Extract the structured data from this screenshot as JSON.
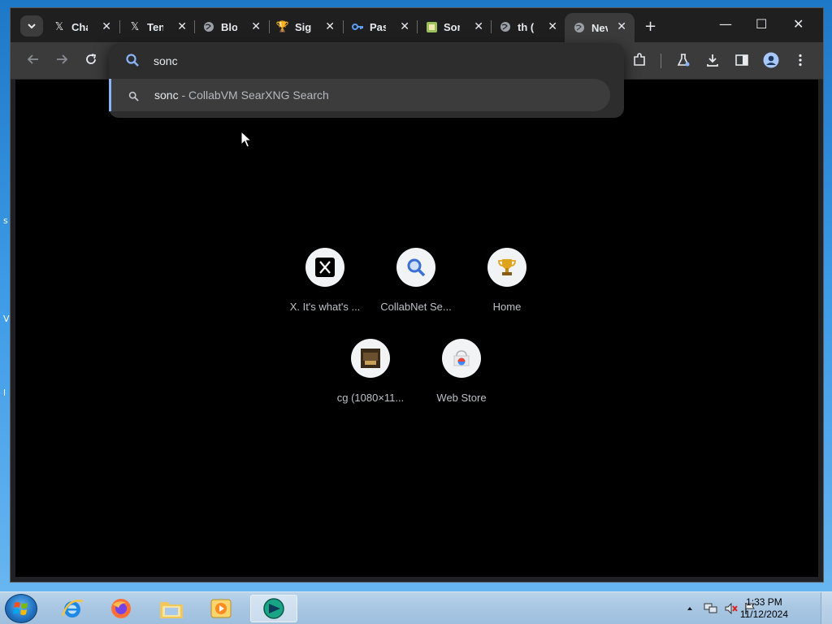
{
  "browser": {
    "tabs": [
      {
        "title": "Cha",
        "favicon": "x-logo-icon"
      },
      {
        "title": "Ten",
        "favicon": "x-logo-icon"
      },
      {
        "title": "Blo",
        "favicon": "globe-icon"
      },
      {
        "title": "Sig",
        "favicon": "trophy-icon"
      },
      {
        "title": "Pas",
        "favicon": "key-icon"
      },
      {
        "title": "Son",
        "favicon": "site-icon"
      },
      {
        "title": "th (",
        "favicon": "globe-icon"
      },
      {
        "title": "Nev",
        "favicon": "globe-icon",
        "active": true
      }
    ],
    "omnibox": {
      "value": "sonc",
      "suggestion": {
        "query": "sonc",
        "separator": " - ",
        "engine": "CollabVM SearXNG Search"
      }
    }
  },
  "shortcuts": [
    {
      "label": "X. It's what's ...",
      "icon": "x-logo-icon"
    },
    {
      "label": "CollabNet Se...",
      "icon": "magnifier-icon"
    },
    {
      "label": "Home",
      "icon": "trophy-icon"
    },
    {
      "label": "cg (1080×11...",
      "icon": "image-thumbnail-icon"
    },
    {
      "label": "Web Store",
      "icon": "web-store-icon"
    }
  ],
  "taskbar": {
    "time": "1:33 PM",
    "date": "11/12/2024"
  },
  "colors": {
    "accent": "#8ab4f8",
    "omnibox_bg": "#2d2d2d",
    "suggestion_bg": "#3c3c3c",
    "page_bg": "#000000"
  }
}
